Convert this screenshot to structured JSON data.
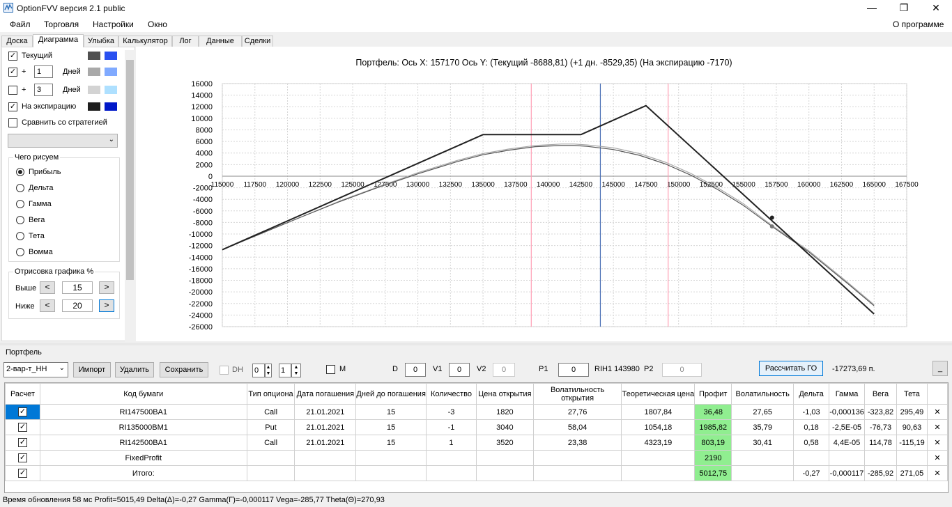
{
  "window": {
    "title": "OptionFVV версия 2.1 public",
    "minimize_icon": "minimize-icon",
    "maximize_icon": "restore-icon",
    "close_icon": "close-icon"
  },
  "menu": {
    "items": [
      "Файл",
      "Торговля",
      "Настройки",
      "Окно"
    ],
    "about": "О программе"
  },
  "tabs": [
    "Доска",
    "Диаграмма",
    "Улыбка",
    "Калькулятор",
    "Лог",
    "Данные",
    "Сделки"
  ],
  "active_tab": "Диаграмма",
  "left": {
    "current": {
      "label": "Текущий",
      "checked": true,
      "color1": "#505050",
      "color2": "#2950f0"
    },
    "plus1": {
      "plus": "+",
      "value": "1",
      "unit": "Дней",
      "checked": true,
      "color1": "#a9a9a9",
      "color2": "#80aaff"
    },
    "plus2": {
      "plus": "+",
      "value": "3",
      "unit": "Дней",
      "checked": false,
      "color1": "#d3d3d3",
      "color2": "#aee0ff"
    },
    "expiry": {
      "label": "На экспирацию",
      "checked": true,
      "color1": "#1e1e1e",
      "color2": "#0018c8"
    },
    "compare": {
      "label": "Сравнить со стратегией",
      "checked": false
    },
    "strategy_combo": "",
    "draw_group": {
      "title": "Чего рисуем",
      "options": [
        "Прибыль",
        "Дельта",
        "Гамма",
        "Вега",
        "Тета",
        "Вомма"
      ],
      "selected": "Прибыль"
    },
    "render_group": {
      "title": "Отрисовка графика %",
      "above_label": "Выше",
      "above_value": "15",
      "below_label": "Ниже",
      "below_value": "20",
      "dec": "<",
      "inc": ">"
    }
  },
  "chart": {
    "header": "Портфель:  Ось X:  157170  Ось Y:   (Текущий  -8688,81)   (+1 дн.  -8529,35)   (На экспирацию  -7170)"
  },
  "chart_data": {
    "type": "line",
    "xlim": [
      115000,
      167500
    ],
    "ylim": [
      -26000,
      16000
    ],
    "x_ticks": [
      "115000",
      "117500",
      "120000",
      "122500",
      "125000",
      "127500",
      "130000",
      "132500",
      "135000",
      "137500",
      "140000",
      "142500",
      "145000",
      "147500",
      "150000",
      "152500",
      "155000",
      "157500",
      "160000",
      "162500",
      "165000",
      "167500"
    ],
    "y_ticks": [
      "16000",
      "14000",
      "12000",
      "10000",
      "8000",
      "6000",
      "4000",
      "2000",
      "0",
      "-2000",
      "-4000",
      "-6000",
      "-8000",
      "-10000",
      "-12000",
      "-14000",
      "-16000",
      "-18000",
      "-20000",
      "-22000",
      "-24000",
      "-26000"
    ],
    "grid": true,
    "vlines": [
      {
        "x": 138700,
        "color": "#ff9eb5"
      },
      {
        "x": 144000,
        "color": "#4a6fb5"
      },
      {
        "x": 149200,
        "color": "#ff9eb5"
      }
    ],
    "series": [
      {
        "color": "#222222",
        "width": 2,
        "x": [
          115000,
          135000,
          142500,
          147500,
          165000
        ],
        "y": [
          -12720,
          7180,
          7180,
          12180,
          -23820
        ]
      },
      {
        "color": "#555555",
        "width": 1.2,
        "x": [
          115000,
          118000,
          121000,
          124000,
          127000,
          130000,
          133000,
          135000,
          137000,
          139000,
          141000,
          142000,
          143000,
          145000,
          147000,
          149000,
          151000,
          153000,
          155000,
          157170,
          160000,
          163000,
          165000
        ],
        "y": [
          -12700,
          -9900,
          -7100,
          -4400,
          -1900,
          400,
          2500,
          3700,
          4500,
          5100,
          5300,
          5300,
          5150,
          4600,
          3600,
          2100,
          100,
          -2300,
          -5100,
          -8689,
          -13100,
          -18600,
          -22400
        ]
      },
      {
        "color": "#a9a9a9",
        "width": 1.2,
        "x": [
          115000,
          118000,
          121000,
          124000,
          127000,
          130000,
          133000,
          135000,
          137000,
          139000,
          141000,
          142000,
          143000,
          145000,
          147000,
          149000,
          151000,
          153000,
          155000,
          157170,
          160000,
          163000,
          165000
        ],
        "y": [
          -12700,
          -9900,
          -7100,
          -4300,
          -1800,
          600,
          2700,
          3900,
          4700,
          5300,
          5550,
          5550,
          5400,
          4900,
          3900,
          2400,
          400,
          -2000,
          -4800,
          -8529,
          -12900,
          -18400,
          -22200
        ]
      }
    ],
    "markers": [
      {
        "x": 157170,
        "y": -7170,
        "color": "#222222"
      },
      {
        "x": 157170,
        "y": -8689,
        "color": "#777777"
      }
    ]
  },
  "portfolio": {
    "title": "Портфель",
    "name_combo": "2-вар-т_НН",
    "import": "Импорт",
    "delete": "Удалить",
    "save": "Сохранить",
    "dh_label": "DH",
    "dh_checked": false,
    "spin1": "0",
    "spin2": "1",
    "m_label": "M",
    "m_checked": false,
    "d_label": "D",
    "d_value": "0",
    "v1_label": "V1",
    "v1_value": "0",
    "v2_label": "V2",
    "v2_value": "0",
    "p1_label": "P1",
    "p1_value": "0",
    "rih_text": "RIH1 143980",
    "p2_label": "P2",
    "p2_value": "0",
    "calc_go": "Рассчитать ГО",
    "go_value": "-17273,69 п.",
    "ellipsis": "_"
  },
  "grid": {
    "columns": [
      "Расчет",
      "Код бумаги",
      "Тип опциона",
      "Дата погашения",
      "Дней до погашения",
      "Количество",
      "Цена открытия",
      "Волатильность открытия",
      "Теоретическая цена",
      "Профит",
      "Волатильность",
      "Дельта",
      "Гамма",
      "Вега",
      "Тета",
      ""
    ],
    "rows": [
      {
        "calc": true,
        "code": "RI147500BA1",
        "type": "Call",
        "date": "21.01.2021",
        "days": "15",
        "qty": "-3",
        "open": "1820",
        "vol_open": "27,76",
        "theo": "1807,84",
        "profit": "36,48",
        "vol": "27,65",
        "delta": "-1,03",
        "gamma": "-0,000136",
        "vega": "-323,82",
        "theta": "295,49",
        "selected": true
      },
      {
        "calc": true,
        "code": "RI135000BM1",
        "type": "Put",
        "date": "21.01.2021",
        "days": "15",
        "qty": "-1",
        "open": "3040",
        "vol_open": "58,04",
        "theo": "1054,18",
        "profit": "1985,82",
        "vol": "35,79",
        "delta": "0,18",
        "gamma": "-2,5E-05",
        "vega": "-76,73",
        "theta": "90,63"
      },
      {
        "calc": true,
        "code": "RI142500BA1",
        "type": "Call",
        "date": "21.01.2021",
        "days": "15",
        "qty": "1",
        "open": "3520",
        "vol_open": "23,38",
        "theo": "4323,19",
        "profit": "803,19",
        "vol": "30,41",
        "delta": "0,58",
        "gamma": "4,4E-05",
        "vega": "114,78",
        "theta": "-115,19"
      },
      {
        "calc": true,
        "code": "FixedProfit",
        "type": "",
        "date": "",
        "days": "",
        "qty": "",
        "open": "",
        "vol_open": "",
        "theo": "",
        "profit": "2190",
        "vol": "",
        "delta": "",
        "gamma": "",
        "vega": "",
        "theta": ""
      },
      {
        "calc": true,
        "code": "Итого:",
        "type": "",
        "date": "",
        "days": "",
        "qty": "",
        "open": "",
        "vol_open": "",
        "theo": "",
        "profit": "5012,75",
        "vol": "",
        "delta": "-0,27",
        "gamma": "-0,000117",
        "vega": "-285,92",
        "theta": "271,05"
      }
    ],
    "delete_glyph": "✕"
  },
  "status": "Время обновления 58 мс  Profit=5015,49 Delta(Δ)=-0,27 Gamma(Γ)=-0,000117 Vega=-285,77 Theta(Θ)=270,93"
}
